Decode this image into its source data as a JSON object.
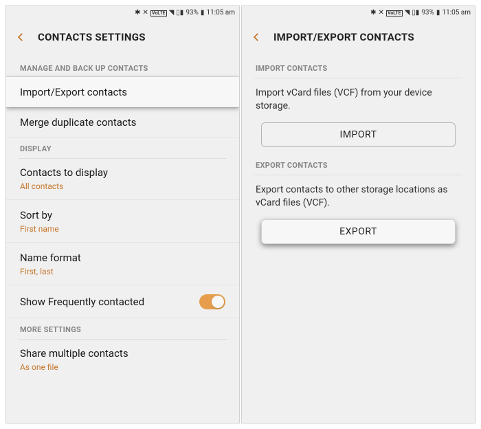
{
  "statusbar": {
    "battery": "93%",
    "time": "11:05 am",
    "bt_icon": "∗",
    "mute_icon": "✕",
    "wifi_icon": "⇡",
    "volte_icon": "LTE",
    "signal_icon": "▮",
    "batt_icon": "▮"
  },
  "left": {
    "title": "CONTACTS SETTINGS",
    "sections": {
      "manage": "MANAGE AND BACK UP CONTACTS",
      "display": "DISPLAY",
      "more": "MORE SETTINGS"
    },
    "rows": {
      "import_export": "Import/Export contacts",
      "merge": "Merge duplicate contacts",
      "contacts_to_display": {
        "title": "Contacts to display",
        "sub": "All contacts"
      },
      "sort_by": {
        "title": "Sort by",
        "sub": "First name"
      },
      "name_format": {
        "title": "Name format",
        "sub": "First, last"
      },
      "freq": "Show Frequently contacted",
      "share": {
        "title": "Share multiple contacts",
        "sub": "As one file"
      }
    }
  },
  "right": {
    "title": "IMPORT/EXPORT CONTACTS",
    "sections": {
      "import": "IMPORT CONTACTS",
      "export": "EXPORT CONTACTS"
    },
    "import_desc": "Import vCard files (VCF) from your device storage.",
    "export_desc": "Export contacts to other storage locations as vCard files (VCF).",
    "import_btn": "IMPORT",
    "export_btn": "EXPORT"
  }
}
